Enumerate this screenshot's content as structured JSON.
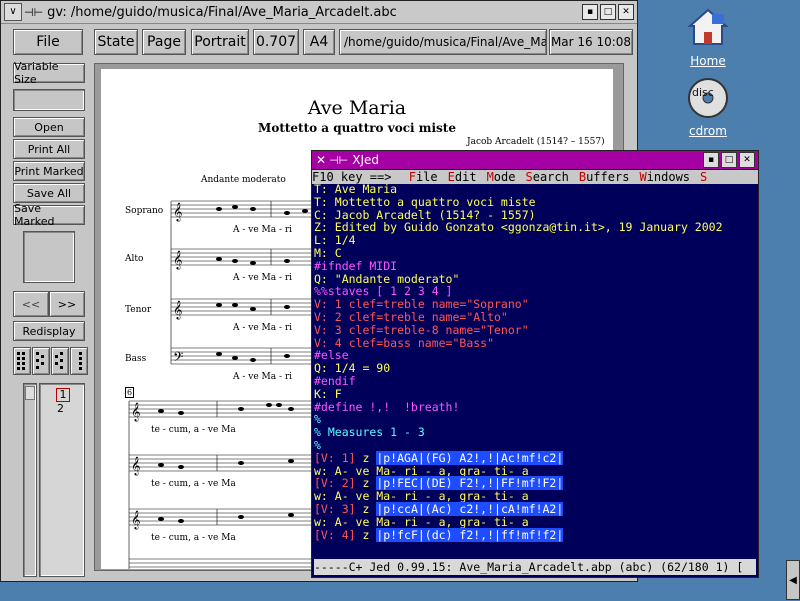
{
  "desktop": {
    "icons": [
      {
        "label": "Home"
      },
      {
        "label": "cdrom"
      }
    ]
  },
  "gv": {
    "title": "gv: /home/guido/musica/Final/Ave_Maria_Arcadelt.abc",
    "toolbar": {
      "file": "File",
      "state": "State",
      "page": "Page",
      "orientation": "Portrait",
      "zoom": "0.707",
      "paper": "A4",
      "path": "/home/guido/musica/Final/Ave_Ma",
      "date": "Mar 16 10:08"
    },
    "side": {
      "variable_size": "Variable Size",
      "open": "Open",
      "print_all": "Print All",
      "print_marked": "Print Marked",
      "save_all": "Save All",
      "save_marked": "Save Marked",
      "prev": "<<",
      "next": ">>",
      "redisplay": "Redisplay",
      "pages": [
        "1",
        "2"
      ]
    },
    "document": {
      "title": "Ave Maria",
      "subtitle": "Mottetto a quattro voci miste",
      "composer": "Jacob Arcadelt (1514? – 1557)",
      "tempo": "Andante moderato",
      "voices": [
        "Soprano",
        "Alto",
        "Tenor",
        "Bass"
      ],
      "lyric_line1": "A - ve Ma - ri",
      "lyric_line2": "te - cum,  a - ve Ma",
      "measure_no": "6"
    }
  },
  "xjed": {
    "title": "XJed",
    "menu": {
      "prefix": "F10 key ==>",
      "items": [
        "File",
        "Edit",
        "Mode",
        "Search",
        "Buffers",
        "Windows",
        "S"
      ]
    },
    "lines": [
      {
        "text": "T: Ave Maria",
        "color": "y"
      },
      {
        "text": "T: Mottetto a quattro voci miste",
        "color": "y"
      },
      {
        "text": "C: Jacob Arcadelt (1514? - 1557)",
        "color": "y"
      },
      {
        "text": "Z: Edited by Guido Gonzato <ggonza@tin.it>, 19 January 2002",
        "color": "y"
      },
      {
        "text": "L: 1/4",
        "color": "y"
      },
      {
        "text": "M: C",
        "color": "y"
      },
      {
        "text": "#ifndef MIDI",
        "color": "m"
      },
      {
        "text": "Q: \"Andante moderato\"",
        "color": "y"
      },
      {
        "text": "%%staves [ 1 2 3 4 ]",
        "color": "m"
      },
      {
        "text": "V: 1 clef=treble name=\"Soprano\"",
        "color": "r"
      },
      {
        "text": "V: 2 clef=treble name=\"Alto\"",
        "color": "r"
      },
      {
        "text": "V: 3 clef=treble-8 name=\"Tenor\"",
        "color": "r"
      },
      {
        "text": "V: 4 clef=bass name=\"Bass\"",
        "color": "r"
      },
      {
        "text": "#else",
        "color": "m"
      },
      {
        "text": "Q: 1/4 = 90",
        "color": "y"
      },
      {
        "text": "#endif",
        "color": "m"
      },
      {
        "text": "K: F",
        "color": "y"
      },
      {
        "text": "#define !,!  !breath!",
        "color": "m"
      },
      {
        "text": "%",
        "color": "c"
      },
      {
        "text": "% Measures 1 - 3",
        "color": "c"
      },
      {
        "text": "%",
        "color": "c"
      },
      {
        "text": "[V: 1] z |p!AGA|(FG) A2!,!|Ac!mf!c2|",
        "color": "mix"
      },
      {
        "text": "w: A- ve Ma- ri - a, gra- ti- a",
        "color": "y"
      },
      {
        "text": "[V: 2] z |p!FEC|(DE) F2!,!|FF!mf!F2|",
        "color": "mix"
      },
      {
        "text": "w: A- ve Ma- ri - a, gra- ti- a",
        "color": "y"
      },
      {
        "text": "[V: 3] z |p!ccA|(Ac) c2!,!|cA!mf!A2|",
        "color": "mix"
      },
      {
        "text": "w: A- ve Ma- ri - a, gra- ti- a",
        "color": "y"
      },
      {
        "text": "[V: 4] z |p!fcF|(dc) f2!,!|ff!mf!f2|",
        "color": "mix"
      }
    ],
    "status": "-----C+ Jed 0.99.15: Ave_Maria_Arcadelt.abp (abc) (62/180 1) ["
  },
  "colors": {
    "desktop": "#4d7fae",
    "jed_bg": "#00005a",
    "jed_title": "#a400a4",
    "window_gray": "#c6c6c6"
  }
}
